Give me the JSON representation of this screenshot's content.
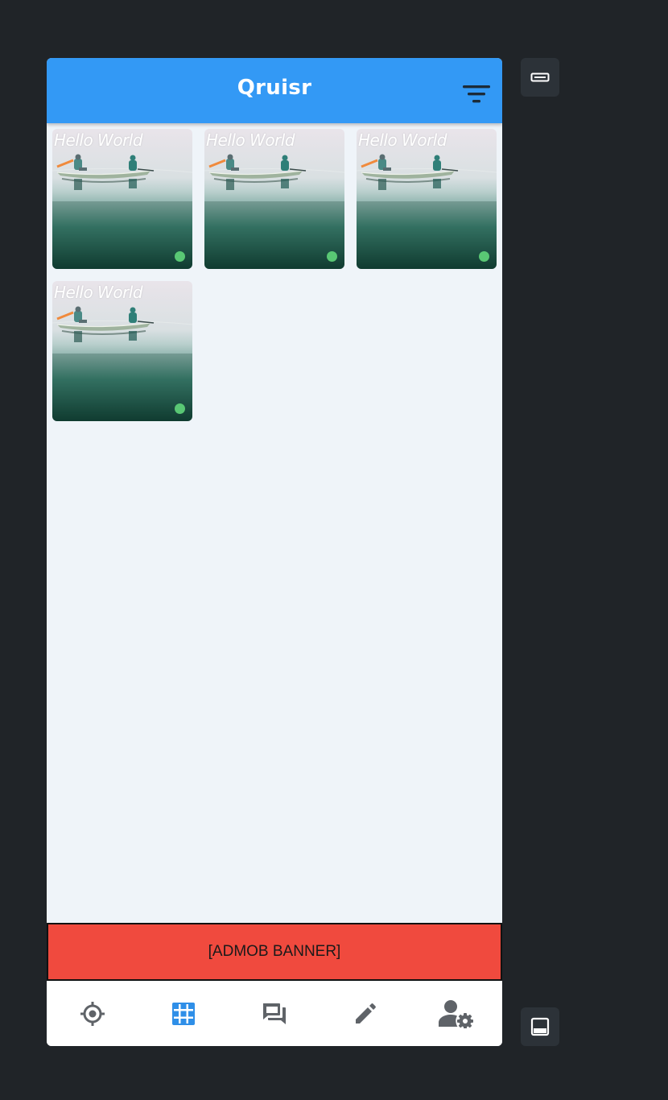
{
  "app": {
    "title": "Qruisr"
  },
  "grid": {
    "tiles": [
      {
        "label": "Hello World",
        "online": true
      },
      {
        "label": "Hello World",
        "online": true
      },
      {
        "label": "Hello World",
        "online": true
      },
      {
        "label": "Hello World",
        "online": true
      }
    ]
  },
  "banner": {
    "text": "[ADMOB BANNER]"
  },
  "bottom_nav": {
    "items": [
      {
        "icon": "location-target-icon",
        "active": false
      },
      {
        "icon": "grid-icon",
        "active": true
      },
      {
        "icon": "forum-icon",
        "active": false
      },
      {
        "icon": "pencil-icon",
        "active": false
      },
      {
        "icon": "user-settings-icon",
        "active": false
      }
    ]
  },
  "side_buttons": [
    {
      "icon": "keyboard-icon"
    },
    {
      "icon": "bottom-panel-icon"
    }
  ],
  "colors": {
    "appbar": "#3399f5",
    "background": "#eff4f9",
    "banner": "#f04a3e",
    "online": "#59c774",
    "nav_active": "#2f8fe8",
    "nav_inactive": "#5f6368",
    "desktop": "#202428"
  }
}
